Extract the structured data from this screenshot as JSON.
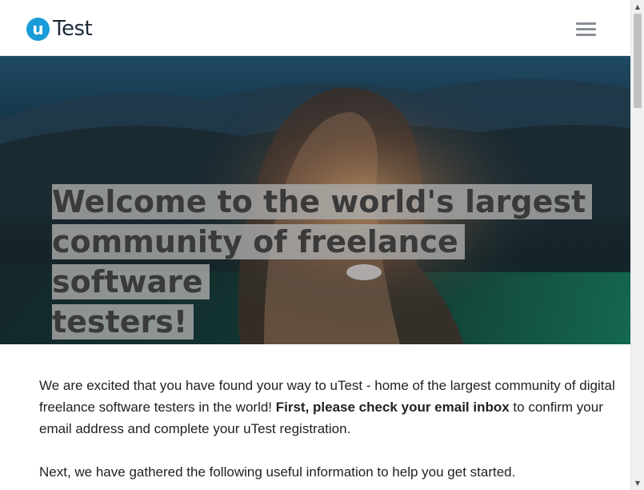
{
  "header": {
    "logo_mark": "u",
    "logo_text": "Test",
    "menu_icon": "hamburger-icon"
  },
  "hero": {
    "title_line1": "Welcome to the world's largest",
    "title_line2": "community of freelance software",
    "title_line3": "testers!"
  },
  "content": {
    "intro_text": "We are excited that you have found your way to uTest - home of the largest community of digital freelance software testers in the world! ",
    "intro_bold": "First, please check your email inbox",
    "intro_end": " to confirm your email address and complete your uTest registration.",
    "next_text": "Next, we have gathered the following useful information to help you get started."
  },
  "scrollbar": {
    "up_arrow": "▲",
    "down_arrow": "▼"
  },
  "colors": {
    "brand": "#1a9cd8",
    "text": "#222222",
    "title_highlight": "#aaaaaa"
  }
}
